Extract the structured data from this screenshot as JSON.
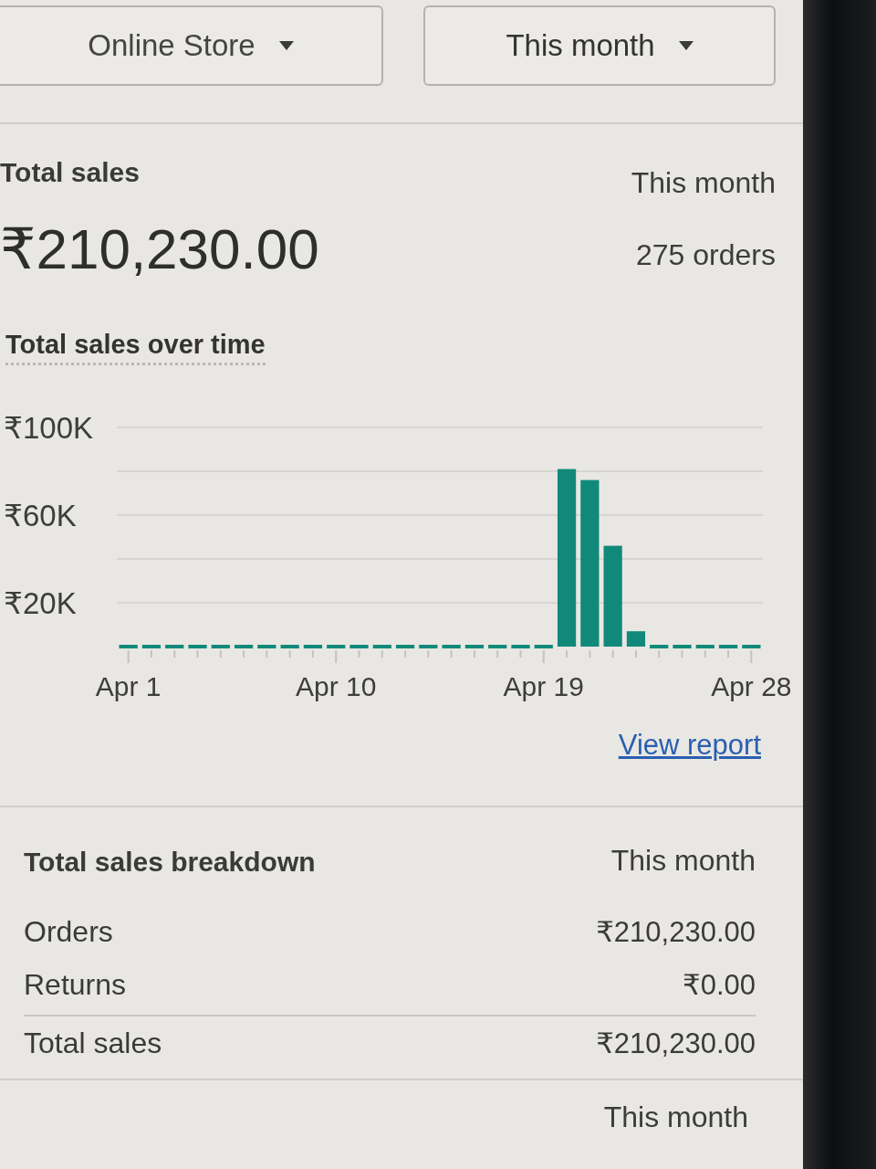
{
  "filters": [
    {
      "label": "Online Store"
    },
    {
      "label": "This month"
    }
  ],
  "total_sales": {
    "title": "Total sales",
    "period": "This month",
    "amount": "₹210,230.00",
    "orders": "275 orders"
  },
  "sales_over_time": {
    "chart_data": {
      "type": "bar",
      "title": "Total sales over time",
      "categories": [
        "Apr 1",
        null,
        null,
        null,
        null,
        null,
        null,
        null,
        null,
        "Apr 10",
        null,
        null,
        null,
        null,
        null,
        null,
        null,
        null,
        "Apr 19",
        null,
        null,
        null,
        null,
        null,
        null,
        null,
        null,
        "Apr 28"
      ],
      "series": [
        {
          "color": "#11897a",
          "values": [
            0,
            0,
            0,
            0,
            0,
            0,
            0,
            0,
            0,
            0,
            0,
            0,
            0,
            0,
            0,
            0,
            0,
            0,
            0,
            81000,
            76000,
            46000,
            7000,
            0,
            0,
            0,
            0,
            0
          ]
        }
      ],
      "ylim": [
        0,
        100000
      ],
      "yticks": [
        {
          "value": 20000,
          "label": "₹20K"
        },
        {
          "value": 60000,
          "label": "₹60K"
        },
        {
          "value": 100000,
          "label": "₹100K"
        }
      ]
    },
    "link": "View report"
  },
  "breakdown": {
    "title": "Total sales breakdown",
    "period": "This month",
    "rows": [
      {
        "label": "Orders",
        "value": "₹210,230.00",
        "kind": "line"
      },
      {
        "label": "Returns",
        "value": "₹0.00",
        "kind": "line"
      },
      {
        "label": "Total sales",
        "value": "₹210,230.00",
        "kind": "total"
      }
    ]
  },
  "next_section": {
    "period": "This month"
  }
}
